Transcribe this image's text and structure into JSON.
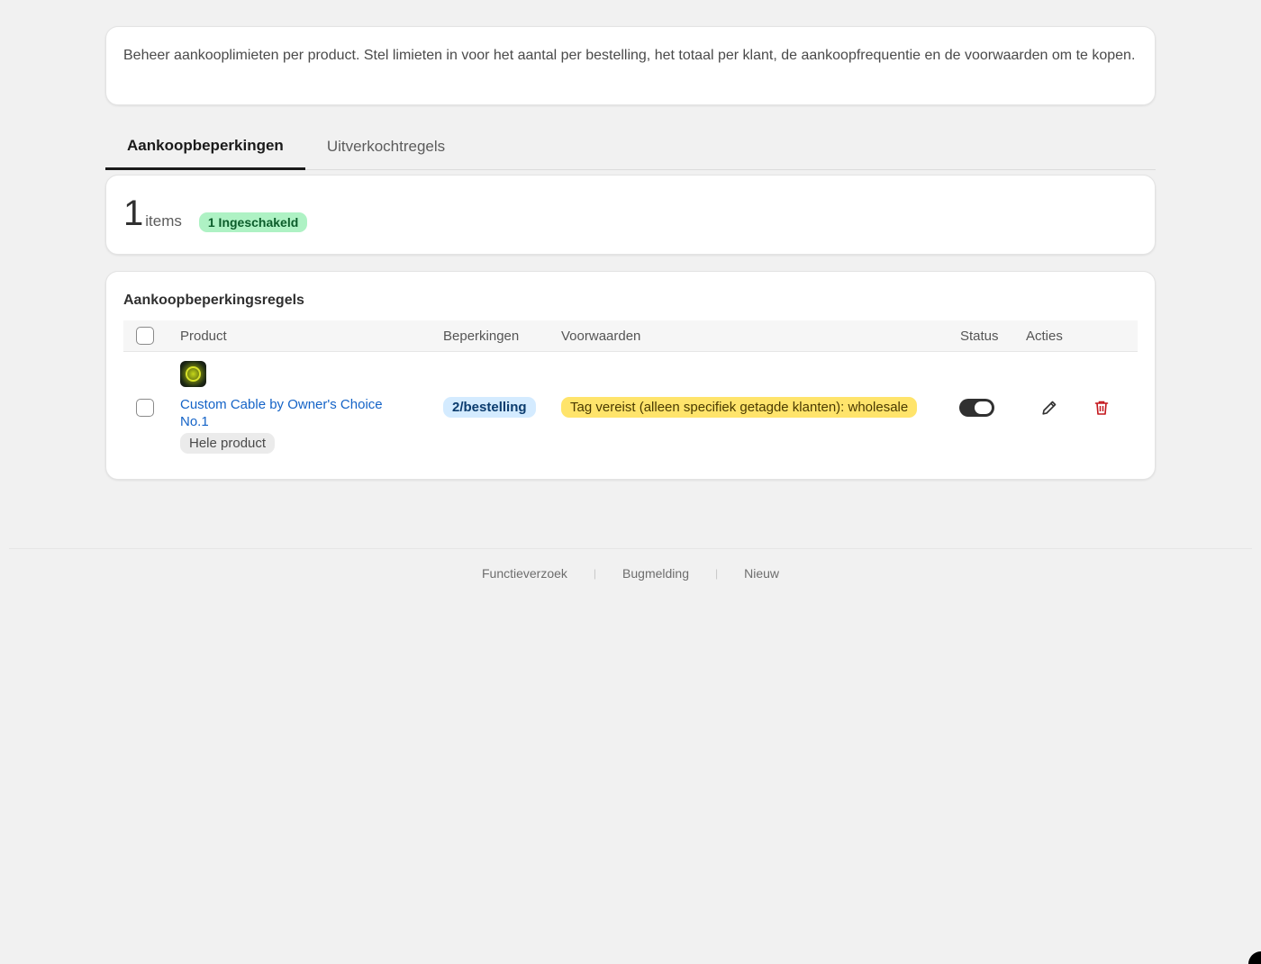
{
  "intro": {
    "text": "Beheer aankooplimieten per product. Stel limieten in voor het aantal per bestelling, het totaal per klant, de aankoopfrequentie en de voorwaarden om te kopen."
  },
  "tabs": [
    {
      "label": "Aankoopbeperkingen",
      "active": true
    },
    {
      "label": "Uitverkochtregels",
      "active": false
    }
  ],
  "summary": {
    "count": "1",
    "count_label": "items",
    "enabled_badge": "1 Ingeschakeld"
  },
  "rules": {
    "title": "Aankoopbeperkingsregels",
    "columns": {
      "product": "Product",
      "limits": "Beperkingen",
      "conditions": "Voorwaarden",
      "status": "Status",
      "actions": "Acties"
    },
    "rows": [
      {
        "product_name": "Custom Cable by Owner's Choice No.1",
        "scope": "Hele product",
        "limit": "2/bestelling",
        "condition": "Tag vereist (alleen specifiek getagde klanten): wholesale",
        "enabled": true
      }
    ]
  },
  "footer": {
    "links": [
      "Functieverzoek",
      "Bugmelding",
      "Nieuw"
    ]
  },
  "colors": {
    "enabled_badge_bg": "#aef2c4",
    "limit_pill_bg": "#d4ebff",
    "condition_pill_bg": "#ffe46b",
    "link": "#1463c7",
    "delete": "#c4161c"
  }
}
